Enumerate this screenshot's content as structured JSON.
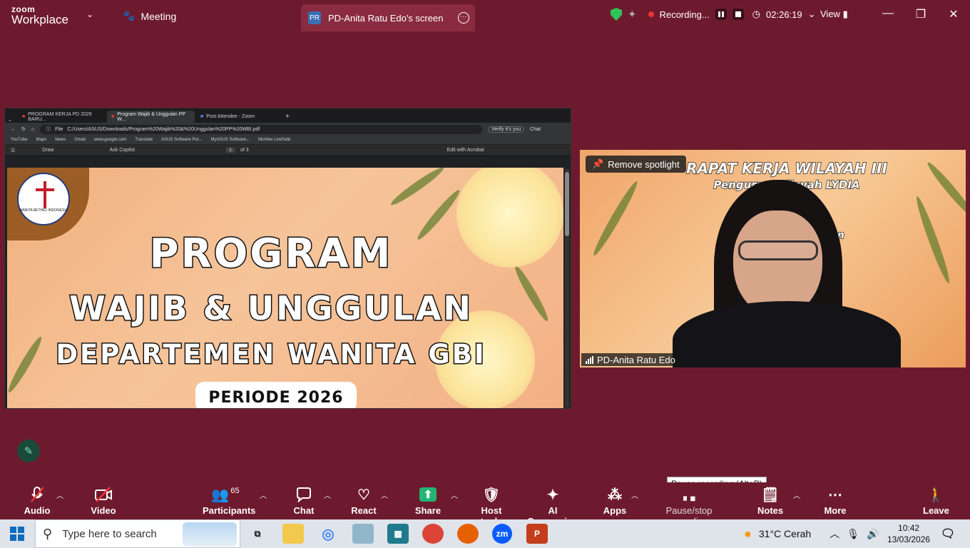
{
  "app": {
    "logo_line1": "zoom",
    "logo_line2": "Workplace",
    "meeting_label": "Meeting"
  },
  "share_tab": {
    "badge": "PR",
    "title": "PD-Anita Ratu Edo's screen"
  },
  "recording": {
    "status": "Recording...",
    "elapsed": "02:26:19",
    "view_label": "View"
  },
  "browser": {
    "tabs": [
      "PROGRAM KERJA PD 2026 BARU...",
      "Program Wajib & Unggulan PP W...",
      "Post Attendee - Zoom"
    ],
    "address_prefix": "File",
    "address": "C:/Users/ASUS/Downloads/Program%20Wajib%20&%20Unggulan%20PP%20WBI.pdf",
    "verify": "Verify it's you",
    "chat": "Chat",
    "bookmarks": [
      "YouTube",
      "Maps",
      "News",
      "Gmail",
      "www.google.com",
      "Translate",
      "ASUS Software Por...",
      "MyASUS Software...",
      "McAfee LiveSafe"
    ],
    "pdf_toolbar": {
      "draw": "Draw",
      "copilot": "Ask Copilot",
      "page": "1",
      "of": "of 3",
      "edit": "Edit with Acrobat"
    }
  },
  "slide": {
    "logo_text": "WANITA BETHEL INDONESIA",
    "line1": "PROGRAM",
    "line2": "WAJIB & UNGGULAN",
    "line3": "DEPARTEMEN WANITA GBI",
    "periode": "PERIODE 2026"
  },
  "video": {
    "banner1": "RAPAT KERJA WILAYAH III",
    "banner2": "Pengurus Wilayah LYDIA",
    "banner3": "Jadikan... ...id Tuhan",
    "spotlight": "Remove spotlight",
    "participant_name": "PD-Anita Ratu Edo"
  },
  "toolbar": {
    "audio": "Audio",
    "video": "Video",
    "participants": "Participants",
    "participants_count": "65",
    "chat": "Chat",
    "react": "React",
    "share": "Share",
    "host_tools": "Host tools",
    "ai_companion": "AI Companion",
    "apps": "Apps",
    "pause_stop": "Pause/stop recording",
    "notes": "Notes",
    "more": "More",
    "leave": "Leave",
    "tooltip": "Pause recording (Alt+P)"
  },
  "taskbar": {
    "search_placeholder": "Type here to search",
    "weather": "31°C  Cerah",
    "time": "10:42",
    "date": "13/03/2026",
    "weather_badge": "1"
  },
  "colors": {
    "bg": "#6e1a2e",
    "share_green": "#22b573",
    "accent_blue": "#0f6cbd"
  }
}
